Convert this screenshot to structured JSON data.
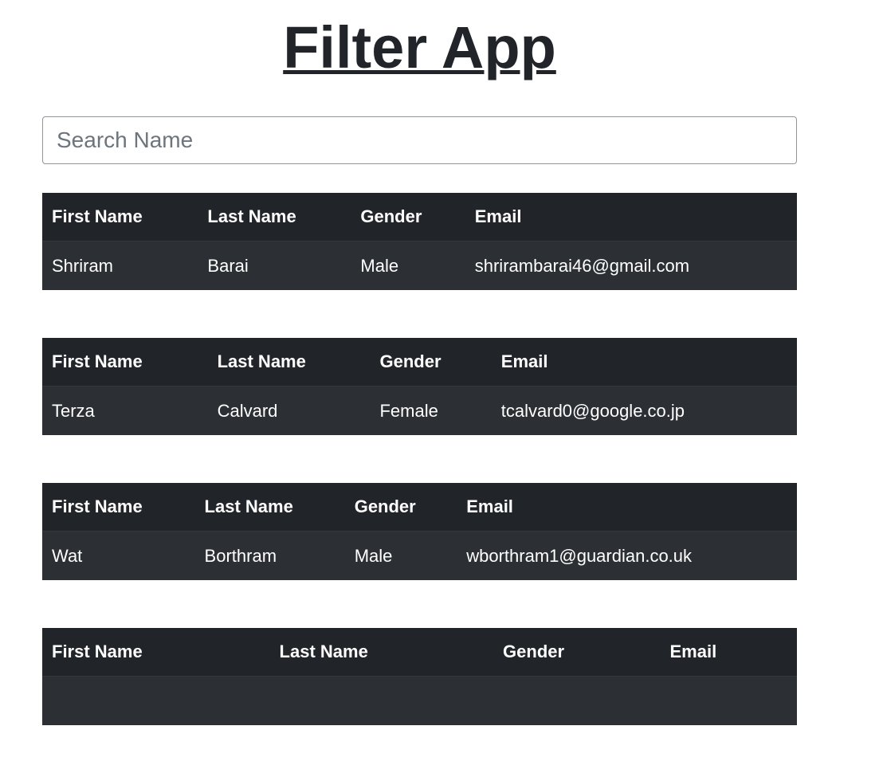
{
  "app_title": "Filter App",
  "search": {
    "placeholder": "Search Name",
    "value": ""
  },
  "columns": [
    "First Name",
    "Last Name",
    "Gender",
    "Email"
  ],
  "people": [
    {
      "first_name": "Shriram",
      "last_name": "Barai",
      "gender": "Male",
      "email": "shrirambarai46@gmail.com"
    },
    {
      "first_name": "Terza",
      "last_name": "Calvard",
      "gender": "Female",
      "email": "tcalvard0@google.co.jp"
    },
    {
      "first_name": "Wat",
      "last_name": "Borthram",
      "gender": "Male",
      "email": "wborthram1@guardian.co.uk"
    },
    {
      "first_name": "",
      "last_name": "",
      "gender": "",
      "email": ""
    }
  ],
  "colors": {
    "header_bg": "#212529",
    "row_bg": "#2c3034",
    "text_light": "#ffffff",
    "title": "#212529"
  }
}
